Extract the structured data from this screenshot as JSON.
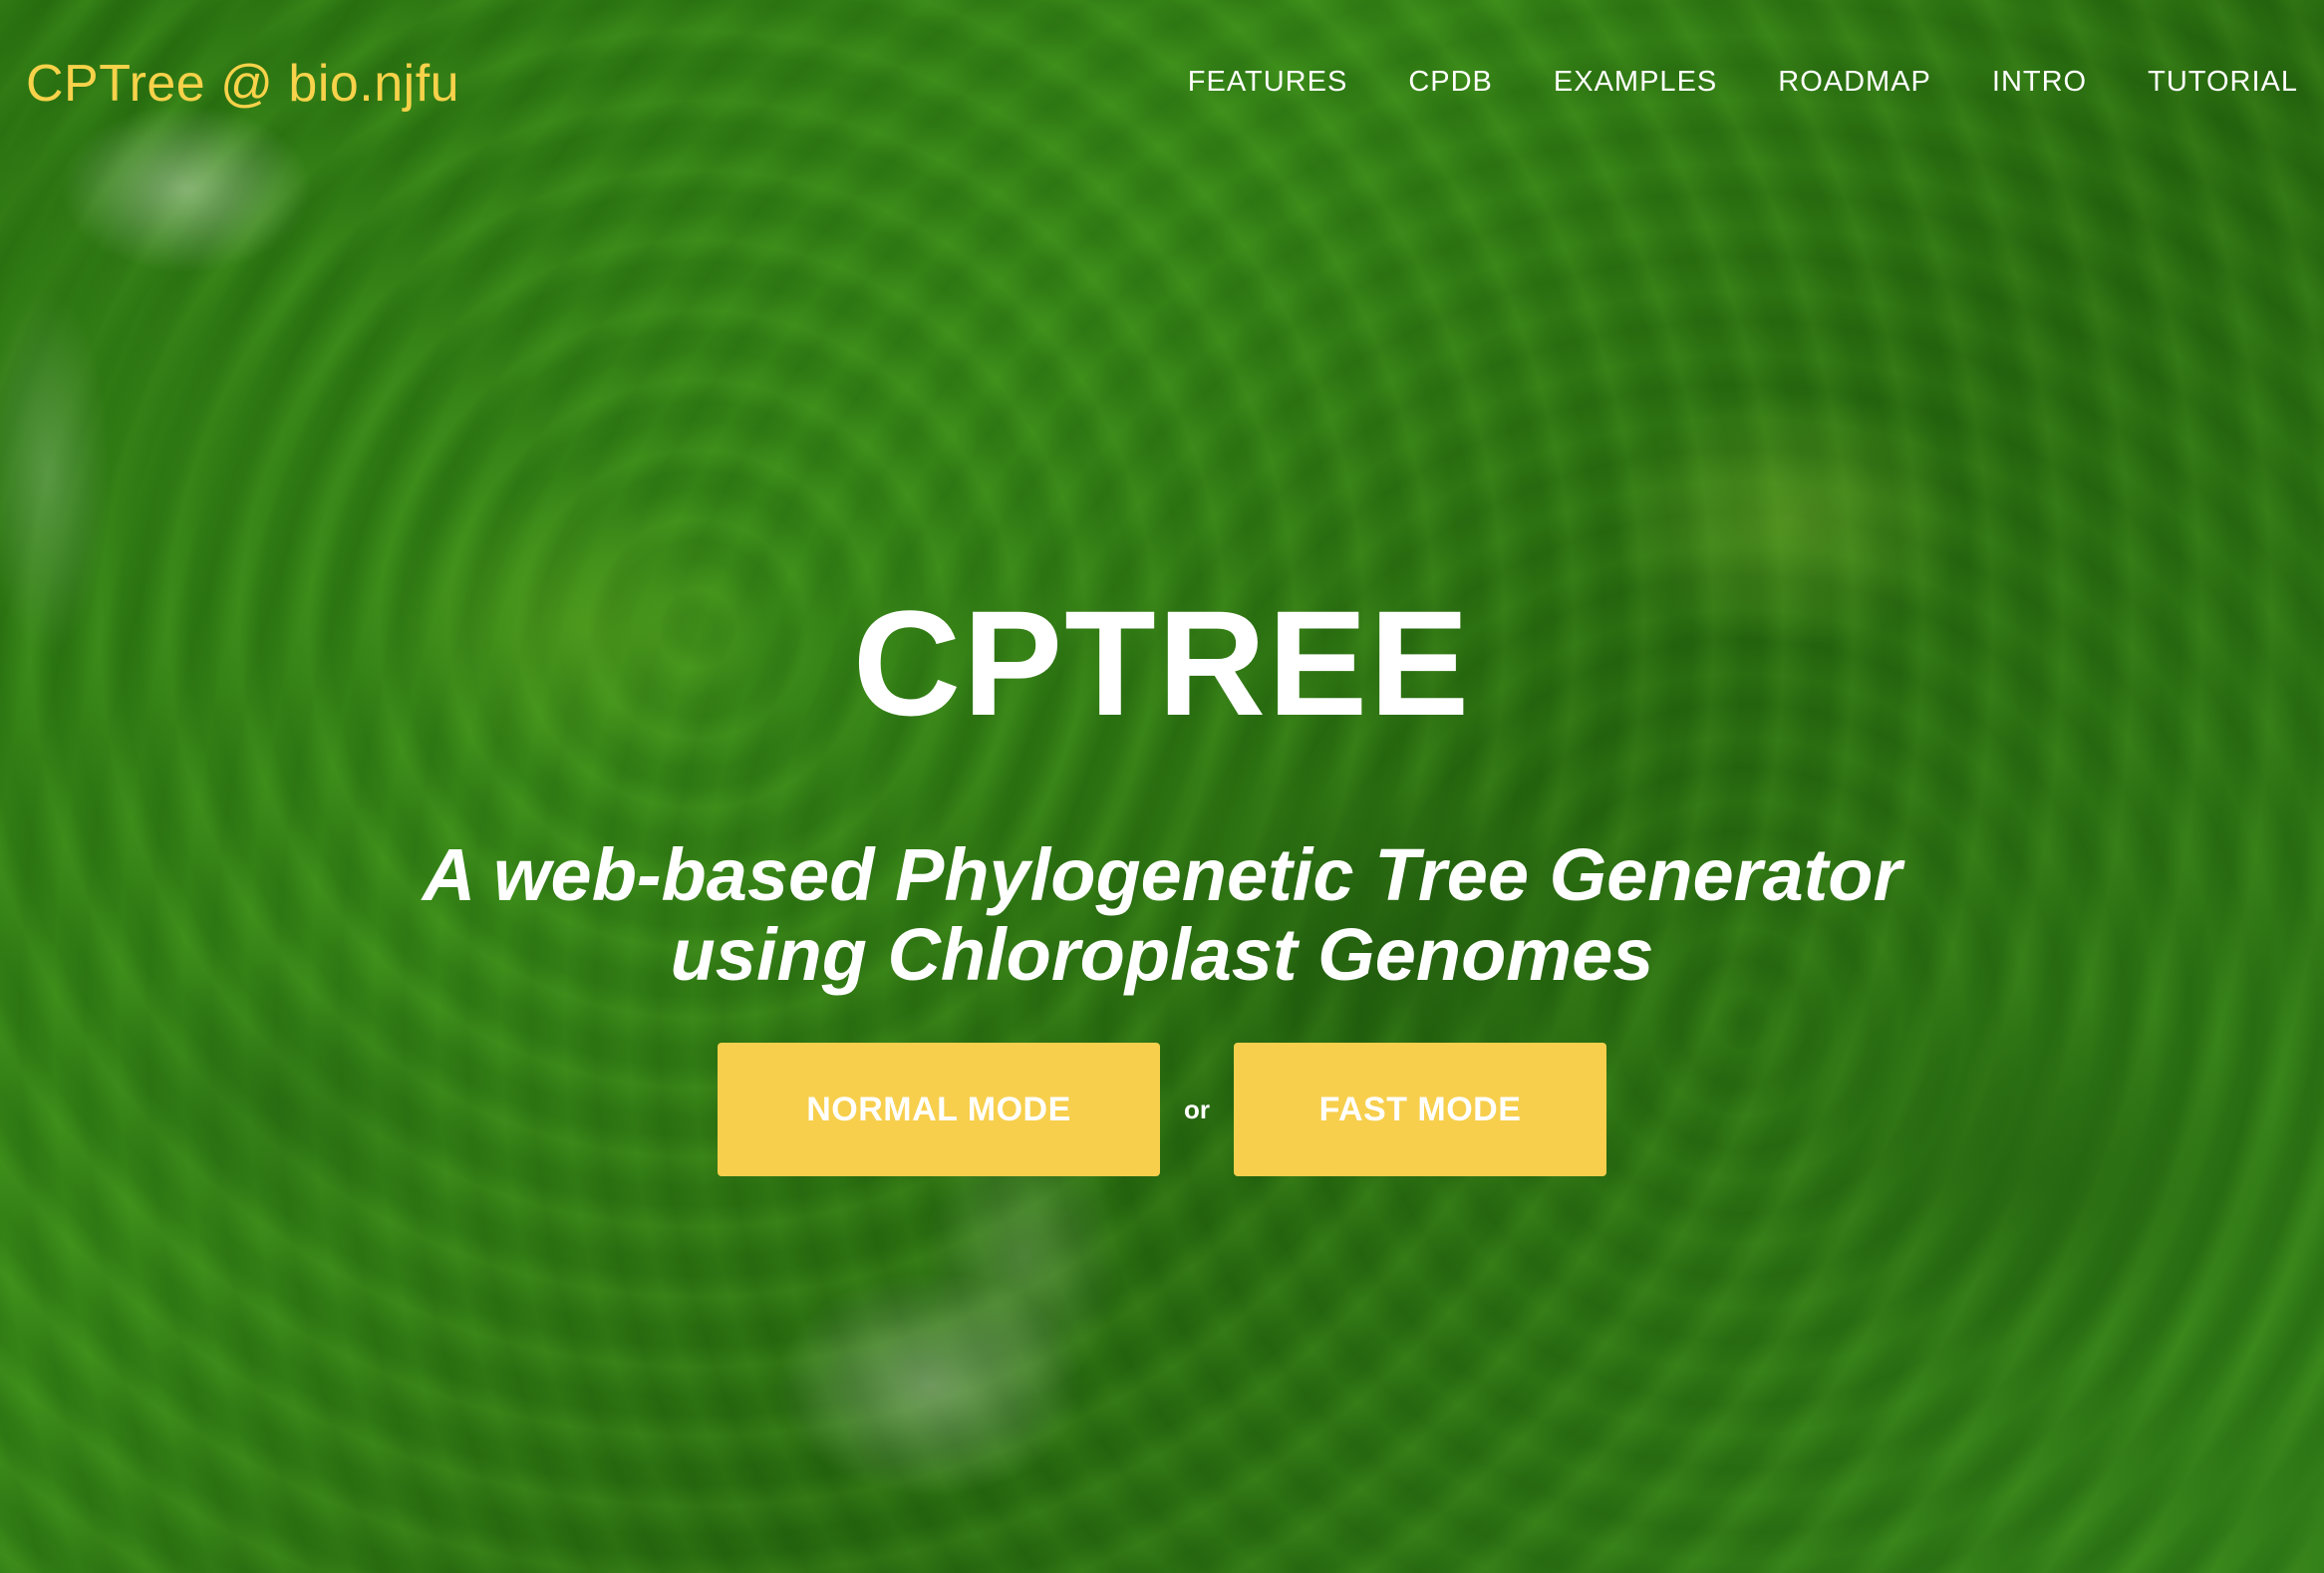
{
  "navbar": {
    "brand": "CPTree @ bio.njfu",
    "links": [
      "FEATURES",
      "CPDB",
      "EXAMPLES",
      "ROADMAP",
      "INTRO",
      "TUTORIAL"
    ]
  },
  "hero": {
    "title": "CPTREE",
    "subtitle_line1": "A web-based Phylogenetic Tree Generator",
    "subtitle_line2": "using Chloroplast Genomes",
    "normal_mode_label": "NORMAL MODE",
    "or_label": "or",
    "fast_mode_label": "FAST MODE"
  },
  "colors": {
    "brand": "#f7d24a",
    "button": "#f7cf4d",
    "text": "#ffffff",
    "background": "#2f7d12"
  }
}
